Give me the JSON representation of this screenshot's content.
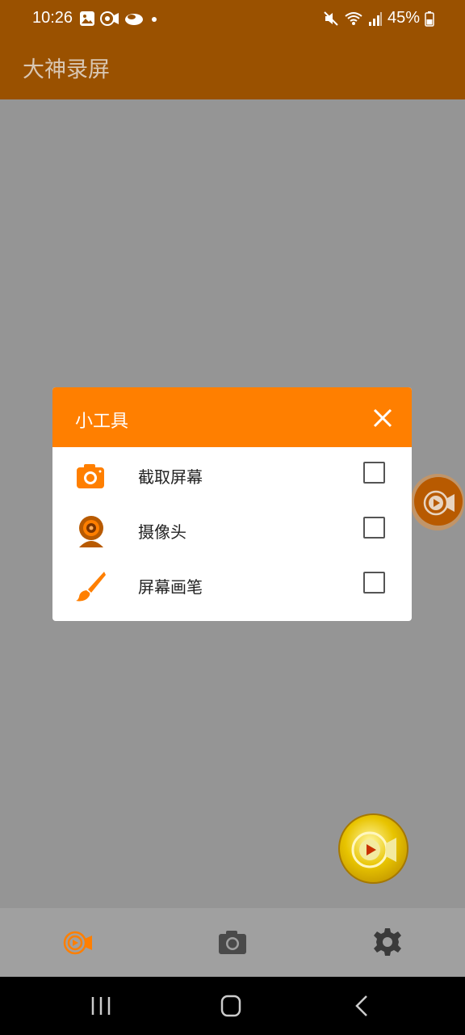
{
  "status_bar": {
    "time": "10:26",
    "battery": "45%",
    "icons": [
      "image-icon",
      "record-icon",
      "cloud-icon",
      "dot-icon",
      "mute-icon",
      "wifi-icon",
      "signal-icon",
      "battery-icon"
    ]
  },
  "app": {
    "title": "大神录屏"
  },
  "dialog": {
    "title": "小工具",
    "items": [
      {
        "label": "截取屏幕",
        "icon": "camera-icon",
        "checked": false
      },
      {
        "label": "摄像头",
        "icon": "webcam-icon",
        "checked": false
      },
      {
        "label": "屏幕画笔",
        "icon": "brush-icon",
        "checked": false
      }
    ]
  },
  "colors": {
    "accent": "#ff7f00",
    "app_bar": "#9a5100"
  },
  "bottom_nav": {
    "items": [
      "record-nav-icon",
      "screenshot-nav-icon",
      "settings-nav-icon"
    ]
  }
}
